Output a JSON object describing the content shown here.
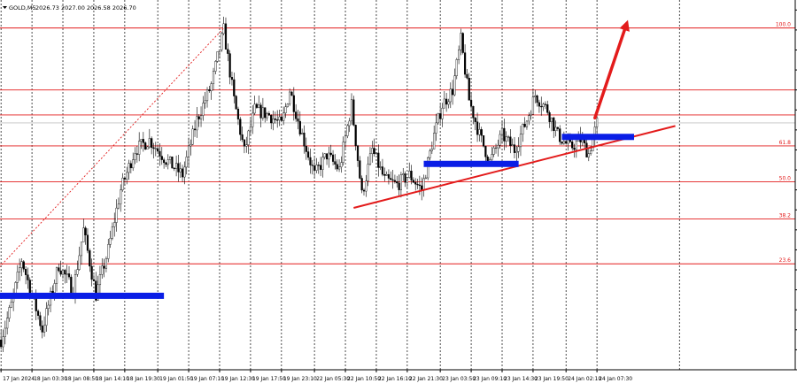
{
  "header": {
    "symbol": "GOLD,M5",
    "quote": "2026.73 2027.00 2026.58 2026.70"
  },
  "colors": {
    "background": "#ffffff",
    "candles": "#000000",
    "grid": "#000000",
    "fib_lines": "#e31b1b",
    "fib_labels": "#e31b1b",
    "trendline": "#e31b1b",
    "arrow": "#e31b1b",
    "zones": "#0a1ee6",
    "diag_dotted": "#e31b1b",
    "current_price_line": "#c0c0c0"
  },
  "chart_data": {
    "type": "candlestick",
    "title": "",
    "x_tick_labels": [
      "17 Jan 2024",
      "18 Jan 03:30",
      "18 Jan 08:50",
      "18 Jan 14:10",
      "18 Jan 19:30",
      "19 Jan 01:50",
      "19 Jan 07:10",
      "19 Jan 12:30",
      "19 Jan 17:50",
      "19 Jan 23:10",
      "22 Jan 05:30",
      "22 Jan 10:50",
      "22 Jan 16:10",
      "22 Jan 21:30",
      "23 Jan 03:50",
      "23 Jan 09:10",
      "23 Jan 14:30",
      "23 Jan 19:50",
      "24 Jan 02:10",
      "24 Jan 07:30"
    ],
    "x_tick_index": [
      0,
      15,
      30,
      45,
      60,
      76,
      91,
      106,
      121,
      136,
      152,
      167,
      182,
      197,
      213,
      228,
      243,
      258,
      274,
      289
    ],
    "total_slots": 350,
    "ylim": [
      2002,
      2039
    ],
    "y_tick_labels_visible": false,
    "fibonacci": {
      "levels": [
        {
          "label": "100.0",
          "price": 2036.2
        },
        {
          "label": "61.8",
          "price": 2024.4
        },
        {
          "label": "50.0",
          "price": 2020.8
        },
        {
          "label": "38.2",
          "price": 2017.1
        },
        {
          "label": "23.6",
          "price": 2012.6
        }
      ],
      "extra_lines": [
        2030.0,
        2027.5
      ]
    },
    "current_price": 2026.7,
    "key_points": [
      {
        "i": 0,
        "p": 2005.0
      },
      {
        "i": 5,
        "p": 2008.5
      },
      {
        "i": 10,
        "p": 2013.0
      },
      {
        "i": 15,
        "p": 2009.5
      },
      {
        "i": 20,
        "p": 2006.0
      },
      {
        "i": 28,
        "p": 2012.5
      },
      {
        "i": 35,
        "p": 2010.0
      },
      {
        "i": 40,
        "p": 2016.0
      },
      {
        "i": 46,
        "p": 2009.5
      },
      {
        "i": 52,
        "p": 2014.0
      },
      {
        "i": 58,
        "p": 2020.0
      },
      {
        "i": 65,
        "p": 2024.0
      },
      {
        "i": 72,
        "p": 2025.0
      },
      {
        "i": 80,
        "p": 2023.0
      },
      {
        "i": 88,
        "p": 2021.5
      },
      {
        "i": 95,
        "p": 2027.0
      },
      {
        "i": 102,
        "p": 2030.5
      },
      {
        "i": 108,
        "p": 2036.0
      },
      {
        "i": 113,
        "p": 2029.0
      },
      {
        "i": 118,
        "p": 2023.8
      },
      {
        "i": 123,
        "p": 2028.0
      },
      {
        "i": 130,
        "p": 2027.5
      },
      {
        "i": 136,
        "p": 2026.5
      },
      {
        "i": 140,
        "p": 2030.0
      },
      {
        "i": 146,
        "p": 2025.5
      },
      {
        "i": 152,
        "p": 2021.5
      },
      {
        "i": 158,
        "p": 2023.5
      },
      {
        "i": 164,
        "p": 2022.0
      },
      {
        "i": 170,
        "p": 2028.5
      },
      {
        "i": 175,
        "p": 2019.5
      },
      {
        "i": 180,
        "p": 2024.0
      },
      {
        "i": 186,
        "p": 2021.0
      },
      {
        "i": 192,
        "p": 2020.5
      },
      {
        "i": 198,
        "p": 2021.5
      },
      {
        "i": 204,
        "p": 2020.0
      },
      {
        "i": 210,
        "p": 2025.5
      },
      {
        "i": 214,
        "p": 2028.5
      },
      {
        "i": 219,
        "p": 2030.0
      },
      {
        "i": 223,
        "p": 2035.0
      },
      {
        "i": 227,
        "p": 2029.0
      },
      {
        "i": 232,
        "p": 2025.5
      },
      {
        "i": 237,
        "p": 2022.8
      },
      {
        "i": 243,
        "p": 2025.5
      },
      {
        "i": 249,
        "p": 2024.0
      },
      {
        "i": 255,
        "p": 2027.0
      },
      {
        "i": 259,
        "p": 2029.5
      },
      {
        "i": 265,
        "p": 2028.0
      },
      {
        "i": 270,
        "p": 2025.5
      },
      {
        "i": 276,
        "p": 2024.2
      },
      {
        "i": 281,
        "p": 2025.0
      },
      {
        "i": 285,
        "p": 2023.6
      },
      {
        "i": 289,
        "p": 2026.7
      }
    ],
    "annotations": {
      "fib_dotted": {
        "from": {
          "i": -2,
          "p": 2012.0
        },
        "to": {
          "i": 108,
          "p": 2036.2
        }
      },
      "trendline": {
        "from": {
          "i": 171,
          "p": 2018.2
        },
        "to": {
          "i": 327,
          "p": 2026.4
        }
      },
      "zones": [
        {
          "from_i": -2,
          "to_i": 79,
          "p": 2009.4
        },
        {
          "from_i": 205,
          "to_i": 251,
          "p": 2022.6
        },
        {
          "from_i": 272,
          "to_i": 307,
          "p": 2025.3
        }
      ],
      "arrow": {
        "from": {
          "i": 288,
          "p": 2027.2
        },
        "to": {
          "i": 304,
          "p": 2037.0
        }
      }
    }
  }
}
